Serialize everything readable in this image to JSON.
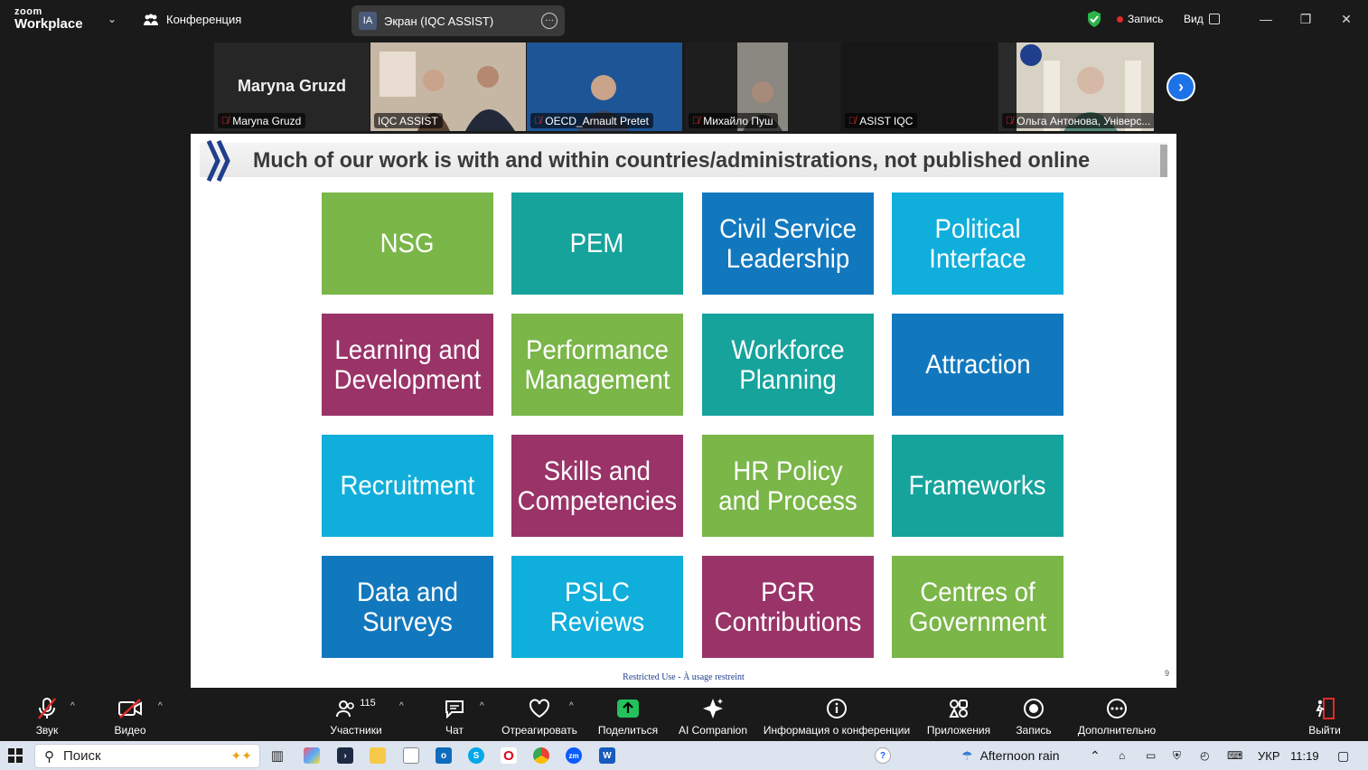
{
  "app": {
    "logo_top": "zoom",
    "logo_bottom": "Workplace",
    "conference_label": "Конференция"
  },
  "screen_share": {
    "initials": "IA",
    "label": "Экран (IQC ASSIST)"
  },
  "titlebar": {
    "recording_label": "Запись",
    "view_label": "Вид"
  },
  "participants": [
    {
      "name": "Maryna Gruzd",
      "big_name": "Maryna Gruzd"
    },
    {
      "name": "IQC ASSIST"
    },
    {
      "name": "OECD_Arnault Pretet"
    },
    {
      "name": "Михайло Пуш"
    },
    {
      "name": "ASIST IQC"
    },
    {
      "name": "Ольга Антонова, Універс..."
    }
  ],
  "slide": {
    "title": "Much of our work is with and within countries/administrations, not published online",
    "tiles": [
      {
        "label": "NSG",
        "color": "#7ab648"
      },
      {
        "label": "PEM",
        "color": "#16a39c"
      },
      {
        "label": "Civil Service Leadership",
        "color": "#1278be"
      },
      {
        "label": "Political Interface",
        "color": "#10aedb"
      },
      {
        "label": "Learning and Development",
        "color": "#9a3368"
      },
      {
        "label": "Performance Management",
        "color": "#7ab648"
      },
      {
        "label": "Workforce Planning",
        "color": "#16a39c"
      },
      {
        "label": "Attraction",
        "color": "#1278be"
      },
      {
        "label": "Recruitment",
        "color": "#10aedb"
      },
      {
        "label": "Skills and Competencies",
        "color": "#9a3368"
      },
      {
        "label": "HR Policy and Process",
        "color": "#7ab648"
      },
      {
        "label": "Frameworks",
        "color": "#16a39c"
      },
      {
        "label": "Data and Surveys",
        "color": "#1278be"
      },
      {
        "label": "PSLC Reviews",
        "color": "#10aedb"
      },
      {
        "label": "PGR Contributions",
        "color": "#9a3368"
      },
      {
        "label": "Centres of Government",
        "color": "#7ab648"
      }
    ],
    "footer": "Restricted Use - À usage restreint",
    "page_number": "9"
  },
  "toolbar": {
    "audio": "Звук",
    "video": "Видео",
    "participants": "Участники",
    "participants_count": "115",
    "chat": "Чат",
    "react": "Отреагировать",
    "share": "Поделиться",
    "ai": "AI Companion",
    "info": "Информация о конференции",
    "apps": "Приложения",
    "record": "Запись",
    "more": "Дополнительно",
    "leave": "Выйти"
  },
  "taskbar": {
    "search_placeholder": "Поиск",
    "weather": "Afternoon rain",
    "language": "УКР",
    "time": "11:19"
  }
}
